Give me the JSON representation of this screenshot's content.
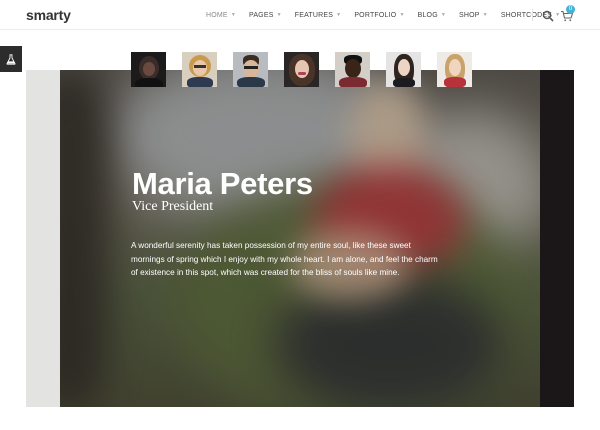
{
  "brand": {
    "logo": "smarty"
  },
  "nav": {
    "items": [
      {
        "label": "HOME",
        "active": true,
        "has_caret": true
      },
      {
        "label": "PAGES",
        "active": false,
        "has_caret": true
      },
      {
        "label": "FEATURES",
        "active": false,
        "has_caret": true
      },
      {
        "label": "PORTFOLIO",
        "active": false,
        "has_caret": true
      },
      {
        "label": "BLOG",
        "active": false,
        "has_caret": true
      },
      {
        "label": "SHOP",
        "active": false,
        "has_caret": true
      },
      {
        "label": "SHORTCODES",
        "active": false,
        "has_caret": true
      }
    ],
    "search_icon": "search-icon",
    "cart_icon": "cart-icon",
    "cart_count": "0"
  },
  "side_tab": {
    "icon": "flask-icon"
  },
  "team": {
    "thumbnails": [
      {
        "name": "team-member-1",
        "selected": false
      },
      {
        "name": "team-member-2",
        "selected": false
      },
      {
        "name": "team-member-3",
        "selected": false
      },
      {
        "name": "team-member-4",
        "selected": false
      },
      {
        "name": "team-member-5",
        "selected": false
      },
      {
        "name": "team-member-6",
        "selected": false
      },
      {
        "name": "team-member-7",
        "selected": true
      }
    ]
  },
  "hero": {
    "name": "Maria Peters",
    "role": "Vice President",
    "bio": "A wonderful serenity has taken possession of my entire soul, like these sweet mornings of spring which I enjoy with my whole heart. I am alone, and feel the charm of existence in this spot, which was created for the bliss of souls like mine."
  },
  "colors": {
    "accent": "#46b1d1",
    "header_text": "#444444",
    "nav_active": "#8a8a8a",
    "side_tab_bg": "#2c2c2c"
  }
}
